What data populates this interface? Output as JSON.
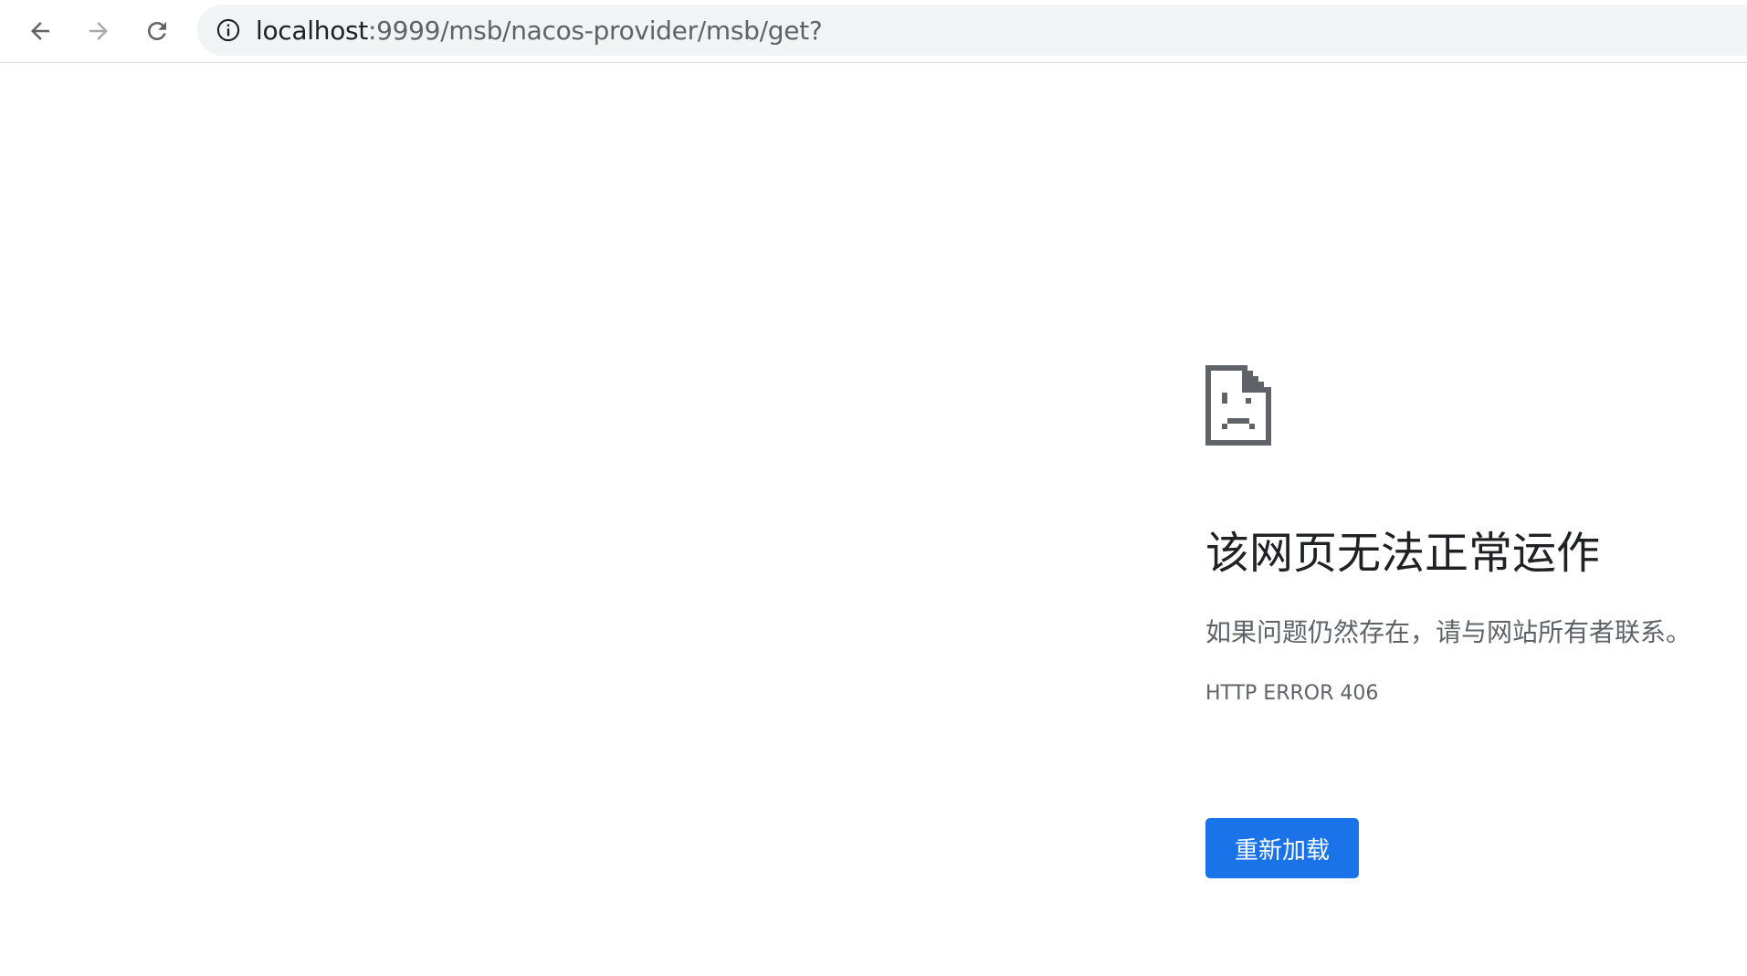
{
  "toolbar": {
    "back_icon": "arrow-left-icon",
    "forward_icon": "arrow-right-icon",
    "reload_icon": "reload-icon",
    "info_icon": "info-icon",
    "url_host": "localhost",
    "url_rest": ":9999/msb/nacos-provider/msb/get?"
  },
  "error": {
    "icon": "sad-page-icon",
    "title": "该网页无法正常运作",
    "message": "如果问题仍然存在，请与网站所有者联系。",
    "code": "HTTP ERROR 406",
    "reload_label": "重新加载"
  },
  "colors": {
    "accent": "#1a73e8",
    "omnibox_bg": "#f1f3f4",
    "text_primary": "#202124",
    "text_secondary": "#5f6368"
  }
}
